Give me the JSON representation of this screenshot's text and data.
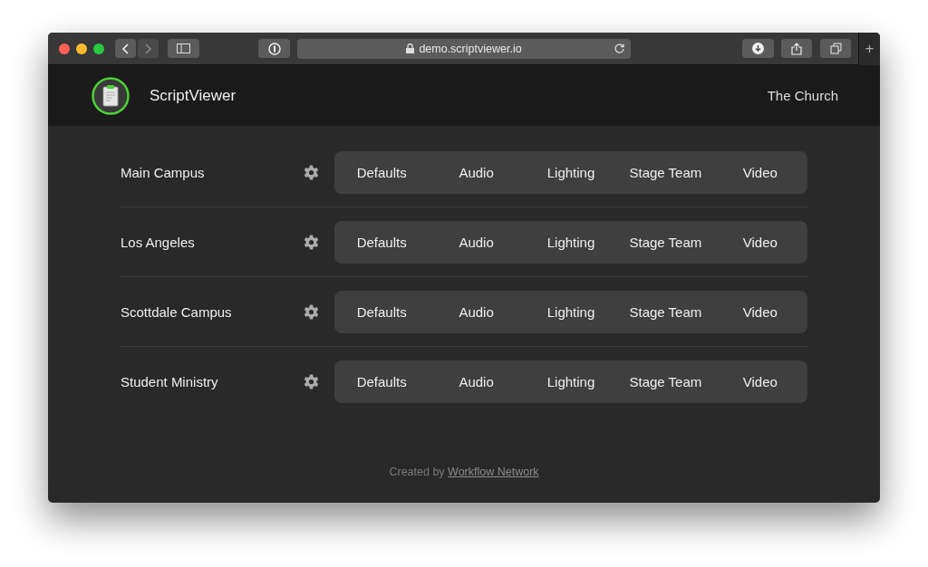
{
  "browser": {
    "url": "demo.scriptviewer.io",
    "new_tab": "+"
  },
  "header": {
    "title": "ScriptViewer",
    "organization": "The Church"
  },
  "campuses": [
    {
      "name": "Main Campus",
      "tabs": [
        "Defaults",
        "Audio",
        "Lighting",
        "Stage Team",
        "Video"
      ]
    },
    {
      "name": "Los Angeles",
      "tabs": [
        "Defaults",
        "Audio",
        "Lighting",
        "Stage Team",
        "Video"
      ]
    },
    {
      "name": "Scottdale Campus",
      "tabs": [
        "Defaults",
        "Audio",
        "Lighting",
        "Stage Team",
        "Video"
      ]
    },
    {
      "name": "Student Ministry",
      "tabs": [
        "Defaults",
        "Audio",
        "Lighting",
        "Stage Team",
        "Video"
      ]
    }
  ],
  "footer": {
    "text": "Created by",
    "link": "Workflow Network"
  }
}
